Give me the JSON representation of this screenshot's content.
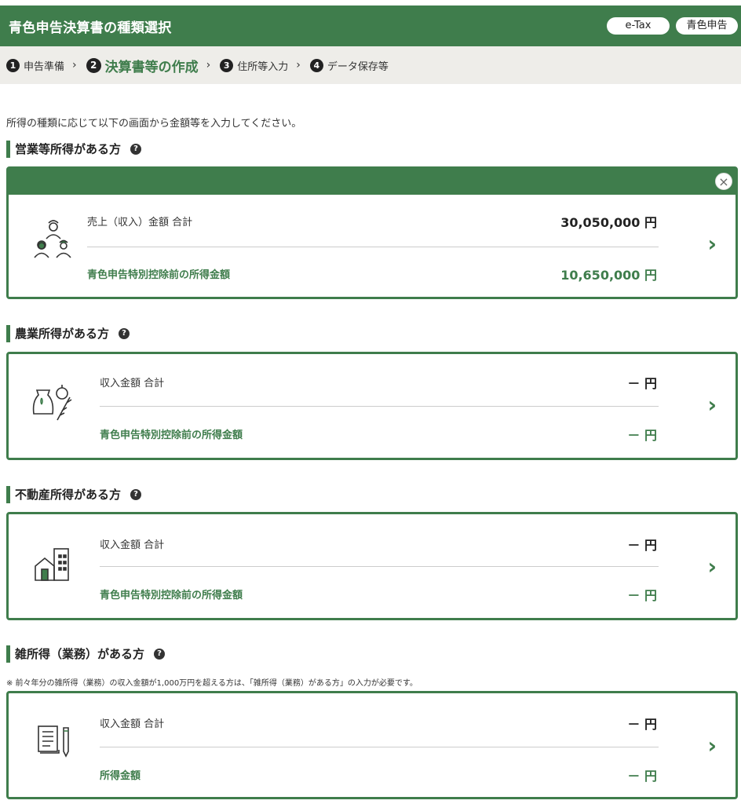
{
  "header": {
    "title": "青色申告決算書の種類選択",
    "badge_etax": "e-Tax",
    "badge_type": "青色申告"
  },
  "steps": [
    {
      "num": "1",
      "label": "申告準備"
    },
    {
      "num": "2",
      "label": "決算書等の作成"
    },
    {
      "num": "3",
      "label": "住所等入力"
    },
    {
      "num": "4",
      "label": "データ保存等"
    }
  ],
  "step_separator": "›",
  "intro": "所得の種類に応じて以下の画面から金額等を入力してください。",
  "help_glyph": "?",
  "chevron_glyph": "›",
  "close_glyph": "×",
  "sections": [
    {
      "title": "営業等所得がある方",
      "icon": "business-people-icon",
      "row1_label": "売上（収入）金額 合計",
      "row1_value": "30,050,000 円",
      "row2_label": "青色申告特別控除前の所得金額",
      "row2_value": "10,650,000 円"
    },
    {
      "title": "農業所得がある方",
      "icon": "farm-produce-icon",
      "row1_label": "収入金額 合計",
      "row1_value": "－ 円",
      "row2_label": "青色申告特別控除前の所得金額",
      "row2_value": "－ 円"
    },
    {
      "title": "不動産所得がある方",
      "icon": "real-estate-building-icon",
      "row1_label": "収入金額 合計",
      "row1_value": "－ 円",
      "row2_label": "青色申告特別控除前の所得金額",
      "row2_value": "－ 円"
    },
    {
      "title": "雑所得（業務）がある方",
      "note": "※ 前々年分の雑所得（業務）の収入金額が1,000万円を超える方は、「雑所得（業務）がある方」の入力が必要です。",
      "icon": "document-pen-icon",
      "row1_label": "収入金額 合計",
      "row1_value": "－ 円",
      "row2_label": "所得金額",
      "row2_value": "－ 円"
    }
  ],
  "colors": {
    "accent": "#3f7d4c",
    "step_bar": "#eeede9"
  }
}
